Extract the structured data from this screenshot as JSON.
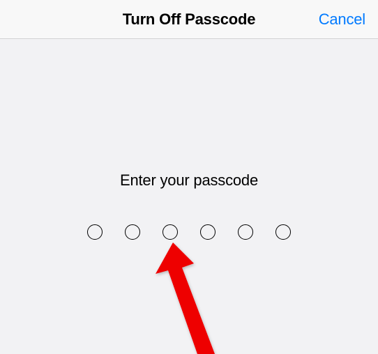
{
  "nav": {
    "title": "Turn Off Passcode",
    "cancel_label": "Cancel"
  },
  "content": {
    "prompt": "Enter your passcode",
    "passcode_length": 6,
    "filled_count": 0
  },
  "colors": {
    "accent": "#007aff",
    "background": "#f2f2f4",
    "nav_background": "#f8f8f8",
    "arrow": "#ee0000"
  }
}
